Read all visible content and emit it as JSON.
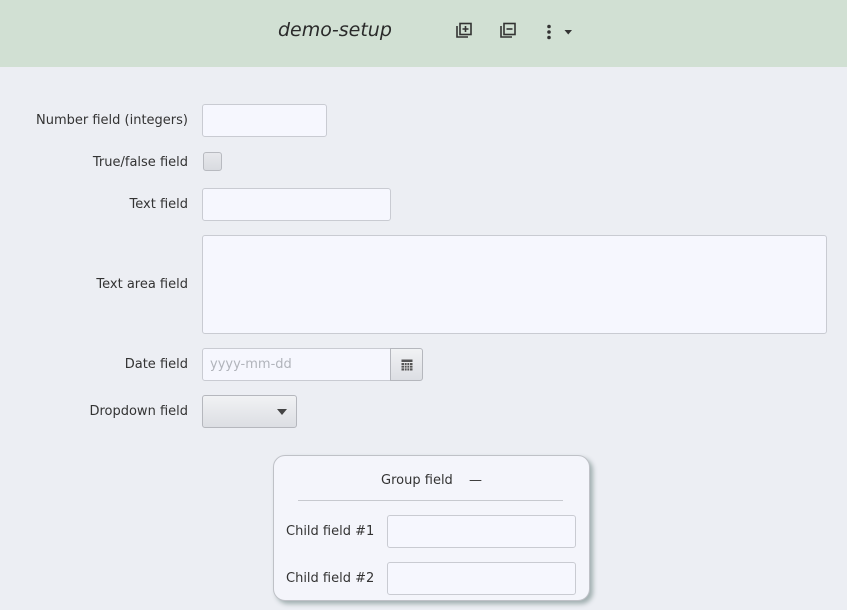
{
  "header": {
    "title": "demo-setup",
    "icons": [
      "expand-all-icon",
      "collapse-all-icon",
      "more-options-icon",
      "dropdown-caret-icon"
    ]
  },
  "form": {
    "number_field": {
      "label": "Number field (integers)",
      "value": ""
    },
    "truefalse_field": {
      "label": "True/false field",
      "checked": false
    },
    "text_field": {
      "label": "Text field",
      "value": ""
    },
    "textarea_field": {
      "label": "Text area field",
      "value": ""
    },
    "date_field": {
      "label": "Date field",
      "placeholder": "yyyy-mm-dd",
      "icon": "calendar-icon"
    },
    "dropdown_field": {
      "label": "Dropdown field",
      "selected": ""
    }
  },
  "group": {
    "title": "Group field",
    "collapse_symbol": "—",
    "child1": {
      "label": "Child field #1",
      "value": ""
    },
    "child2": {
      "label": "Child field #2",
      "value": ""
    }
  },
  "colors": {
    "header_bg": "#d1e0d3",
    "page_bg": "#eceef3",
    "field_bg": "#f6f7fe"
  }
}
